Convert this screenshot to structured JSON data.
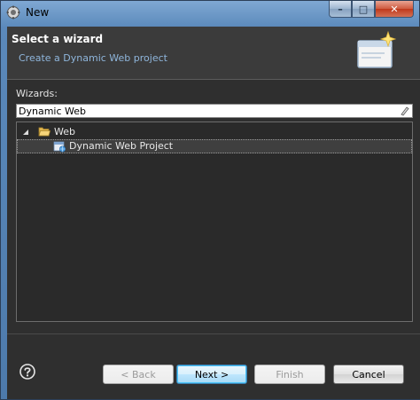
{
  "window": {
    "title": "New",
    "controls": {
      "minimize": "–",
      "maximize": "□",
      "close": "✕"
    }
  },
  "banner": {
    "title": "Select a wizard",
    "subtitle": "Create a Dynamic Web project"
  },
  "wizards": {
    "label": "Wizards:",
    "filter_value": "Dynamic Web"
  },
  "tree": {
    "items": [
      {
        "label": "Web",
        "icon": "folder-open-icon",
        "expanded": true
      },
      {
        "label": "Dynamic Web Project",
        "icon": "dynamic-web-project-icon",
        "selected": true
      }
    ]
  },
  "buttons": {
    "back": "< Back",
    "next": "Next >",
    "finish": "Finish",
    "cancel": "Cancel"
  },
  "colors": {
    "frame": "#5b89bb",
    "client_bg": "#2f2f2f",
    "subtitle": "#8fb6dc"
  }
}
